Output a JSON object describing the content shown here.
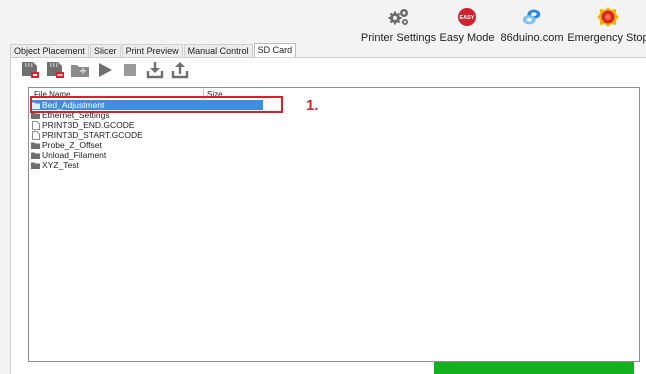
{
  "top_toolbar": {
    "buttons": [
      {
        "label": "Printer Settings",
        "icon": "gears-icon"
      },
      {
        "label": "Easy Mode",
        "icon": "easy-badge-icon",
        "badge_text": "EASY"
      },
      {
        "label": "86duino.com",
        "icon": "86duino-logo-icon"
      },
      {
        "label": "Emergency Stop",
        "icon": "emergency-stop-icon"
      }
    ]
  },
  "tabs": [
    {
      "label": "Object Placement",
      "active": false
    },
    {
      "label": "Slicer",
      "active": false
    },
    {
      "label": "Print Preview",
      "active": false
    },
    {
      "label": "Manual Control",
      "active": false
    },
    {
      "label": "SD Card",
      "active": true
    }
  ],
  "sd_toolbar": {
    "buttons": [
      "sd-mount-icon",
      "sd-unmount-icon",
      "new-folder-icon",
      "play-icon",
      "stop-icon",
      "download-icon",
      "upload-icon"
    ]
  },
  "file_list": {
    "columns": {
      "name": "File Name",
      "size": "Size"
    },
    "rows": [
      {
        "name": "Bed_Adjustment",
        "type": "folder",
        "selected": true
      },
      {
        "name": "Ethernet_Settings",
        "type": "folder",
        "selected": false
      },
      {
        "name": "PRINT3D_END.GCODE",
        "type": "file",
        "selected": false
      },
      {
        "name": "PRINT3D_START.GCODE",
        "type": "file",
        "selected": false
      },
      {
        "name": "Probe_Z_Offset",
        "type": "folder",
        "selected": false
      },
      {
        "name": "Unload_Filament",
        "type": "folder",
        "selected": false
      },
      {
        "name": "XYZ_Test",
        "type": "folder",
        "selected": false
      }
    ]
  },
  "annotation": {
    "callout": "1."
  },
  "progress": {
    "fraction": 1.0
  },
  "colors": {
    "accent_red": "#d6222c",
    "selection_blue": "#3d8fe0",
    "progress_green": "#12b11d",
    "icon_gray": "#6f6f6f"
  }
}
